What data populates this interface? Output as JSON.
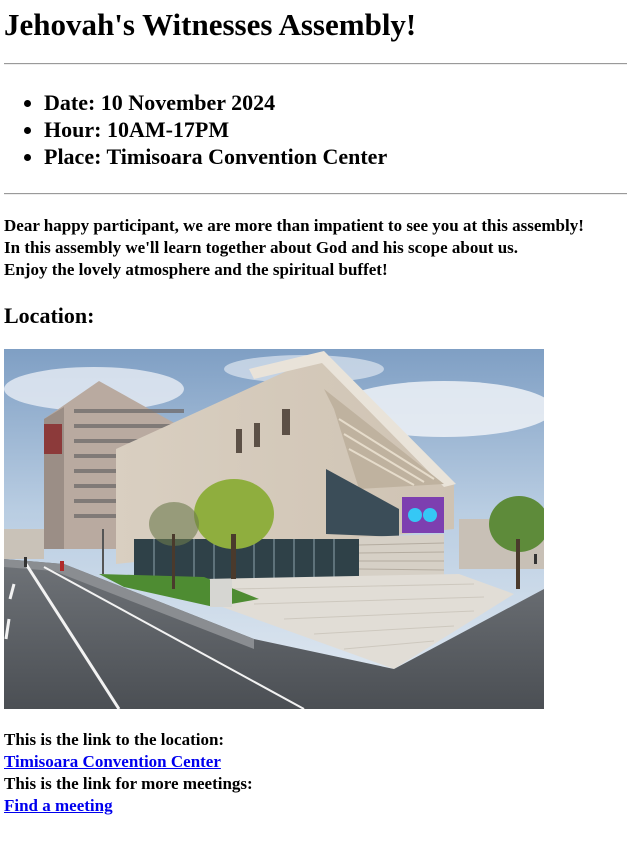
{
  "header": {
    "title": "Jehovah's Witnesses Assembly!"
  },
  "details": [
    "Date: 10 November 2024",
    "Hour: 10AM-17PM",
    "Place: Timisoara Convention Center"
  ],
  "message": {
    "line1": "Dear happy participant, we are more than impatient to see you at this assembly!",
    "line2": "In this assembly we'll learn together about God and his scope about us.",
    "line3": "Enjoy the lovely atmosphere and the spiritual buffet!"
  },
  "location": {
    "heading": "Location:"
  },
  "links": {
    "location_intro": "This is the link to the location:",
    "location_link": "Timisoara Convention Center",
    "meetings_intro": "This is the link for more meetings:",
    "meetings_link": "Find a meeting"
  },
  "colors": {
    "link": "#0000ee",
    "rule": "#9a9a9a"
  }
}
